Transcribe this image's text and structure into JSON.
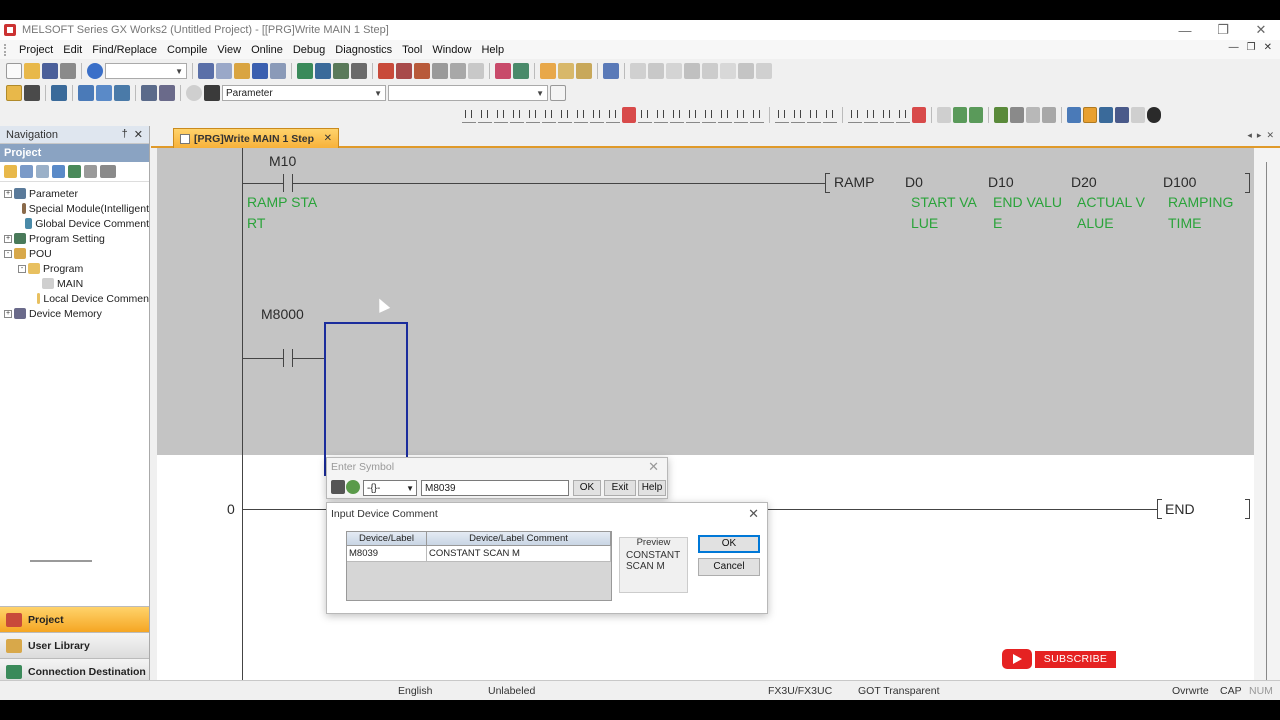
{
  "window": {
    "title": "MELSOFT Series GX Works2 (Untitled Project) - [[PRG]Write MAIN 1 Step]",
    "controls": [
      "—",
      "❐",
      "✕"
    ]
  },
  "menu": [
    "Project",
    "Edit",
    "Find/Replace",
    "Compile",
    "View",
    "Online",
    "Debug",
    "Diagnostics",
    "Tool",
    "Window",
    "Help"
  ],
  "menu_right": [
    "—",
    "❐",
    "✕"
  ],
  "toolbar": {
    "parameter_combo": "Parameter"
  },
  "navigation": {
    "title": "Navigation",
    "pin": "†",
    "close": "✕",
    "section": "Project",
    "tree": [
      {
        "label": "Parameter",
        "exp": "+",
        "level": 0
      },
      {
        "label": "Special Module(Intelligent",
        "exp": "",
        "level": 1
      },
      {
        "label": "Global Device Comment",
        "exp": "",
        "level": 1
      },
      {
        "label": "Program Setting",
        "exp": "+",
        "level": 0
      },
      {
        "label": "POU",
        "exp": "-",
        "level": 0
      },
      {
        "label": "Program",
        "exp": "-",
        "level": 1
      },
      {
        "label": "MAIN",
        "exp": "",
        "level": 2
      },
      {
        "label": "Local Device Commen",
        "exp": "",
        "level": 2
      },
      {
        "label": "Device Memory",
        "exp": "+",
        "level": 0
      }
    ],
    "bottom": [
      "Project",
      "User Library",
      "Connection Destination"
    ]
  },
  "tab": {
    "label": "[PRG]Write MAIN 1 Step",
    "close": "✕",
    "arrows": [
      "◂",
      "▸",
      "✕"
    ]
  },
  "ladder": {
    "rung1": {
      "contact": "M10",
      "contact_comment": [
        "RAMP STA",
        "RT"
      ],
      "instruction": "RAMP",
      "operands": [
        "D0",
        "D10",
        "D20",
        "D100"
      ],
      "operand_comments": [
        [
          "START VA",
          "LUE"
        ],
        [
          "END VALU",
          "E"
        ],
        [
          "ACTUAL V",
          "ALUE"
        ],
        [
          "RAMPING",
          "TIME"
        ]
      ]
    },
    "rung2": {
      "contact": "M8000"
    },
    "rung3": {
      "step": "0",
      "instruction": "END"
    }
  },
  "enter_symbol": {
    "title": "Enter Symbol",
    "close": "✕",
    "symbol": "-{}-",
    "value": "M8039",
    "ok": "OK",
    "exit": "Exit",
    "help": "Help"
  },
  "device_comment": {
    "title": "Input Device Comment",
    "close": "✕",
    "col_device": "Device/Label",
    "col_comment": "Device/Label Comment",
    "device": "M8039",
    "comment": "CONSTANT SCAN M",
    "preview_label": "Preview",
    "preview_text": "CONSTANT\nSCAN M",
    "ok": "OK",
    "cancel": "Cancel"
  },
  "statusbar": {
    "language": "English",
    "label": "Unlabeled",
    "plc": "FX3U/FX3UC",
    "connection": "GOT Transparent",
    "mode": "Ovrwrte",
    "cap": "CAP",
    "num": "NUM"
  },
  "overlay": {
    "subscribe": "SUBSCRIBE"
  },
  "colors": {
    "comment_green": "#2aa33a",
    "cursor_blue": "#1a2c9c",
    "tab_orange": "#f7b13a",
    "youtube_red": "#e52222"
  }
}
